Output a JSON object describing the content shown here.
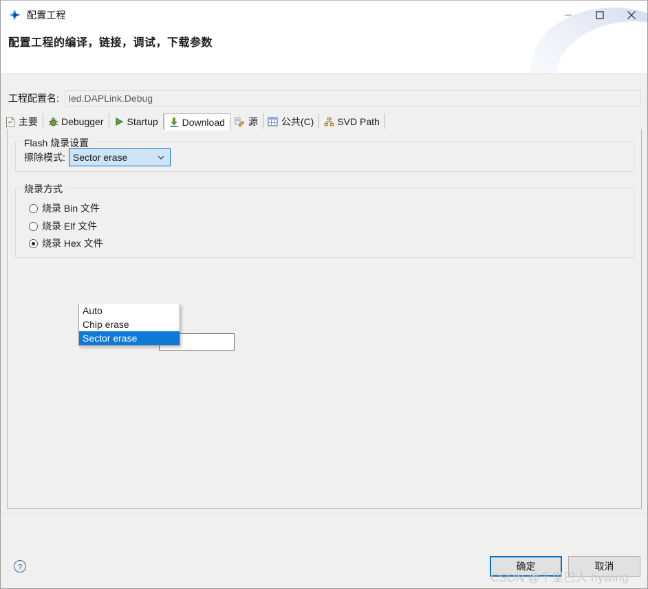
{
  "window": {
    "title": "配置工程",
    "subtitle": "配置工程的编译，链接，调试，下载参数",
    "icon": "app-star-icon",
    "controls": {
      "minimize": "minimize-icon",
      "maximize": "maximize-icon",
      "close": "close-icon"
    }
  },
  "config": {
    "label": "工程配置名:",
    "value": "led.DAPLink.Debug",
    "placeholder": ""
  },
  "tabs": [
    {
      "label": "主要",
      "icon": "document-icon",
      "active": false
    },
    {
      "label": "Debugger",
      "icon": "bug-icon",
      "active": false
    },
    {
      "label": "Startup",
      "icon": "play-icon",
      "active": false
    },
    {
      "label": "Download",
      "icon": "download-icon",
      "active": true
    },
    {
      "label": "源",
      "icon": "source-edit-icon",
      "active": false
    },
    {
      "label": "公共(C)",
      "icon": "table-icon",
      "active": false
    },
    {
      "label": "SVD Path",
      "icon": "hierarchy-icon",
      "active": false
    }
  ],
  "flash_group": {
    "title": "Flash 烧录设置",
    "erase_label": "擦除模式:",
    "combo_value": "Sector erase",
    "combo_arrow": "chevron-down-icon",
    "options": [
      {
        "label": "Auto",
        "selected": false
      },
      {
        "label": "Chip erase",
        "selected": false
      },
      {
        "label": "Sector erase",
        "selected": true
      }
    ]
  },
  "method_group": {
    "title": "烧录方式",
    "options": [
      {
        "label": "烧录 Bin 文件",
        "checked": false
      },
      {
        "label": "烧录 Elf 文件",
        "checked": false
      },
      {
        "label": "烧录 Hex 文件",
        "checked": true
      }
    ],
    "path_value": "",
    "path_placeholder": ""
  },
  "footer": {
    "help": "help-icon",
    "ok_label": "确定",
    "cancel_label": "取消"
  },
  "watermark": "CSDN @千里巴人 hywing",
  "colors": {
    "accent": "#0a6cbe",
    "selection": "#0d7ad8",
    "combo_fill": "#cde5f7",
    "window_bg": "#f0f0f0"
  }
}
